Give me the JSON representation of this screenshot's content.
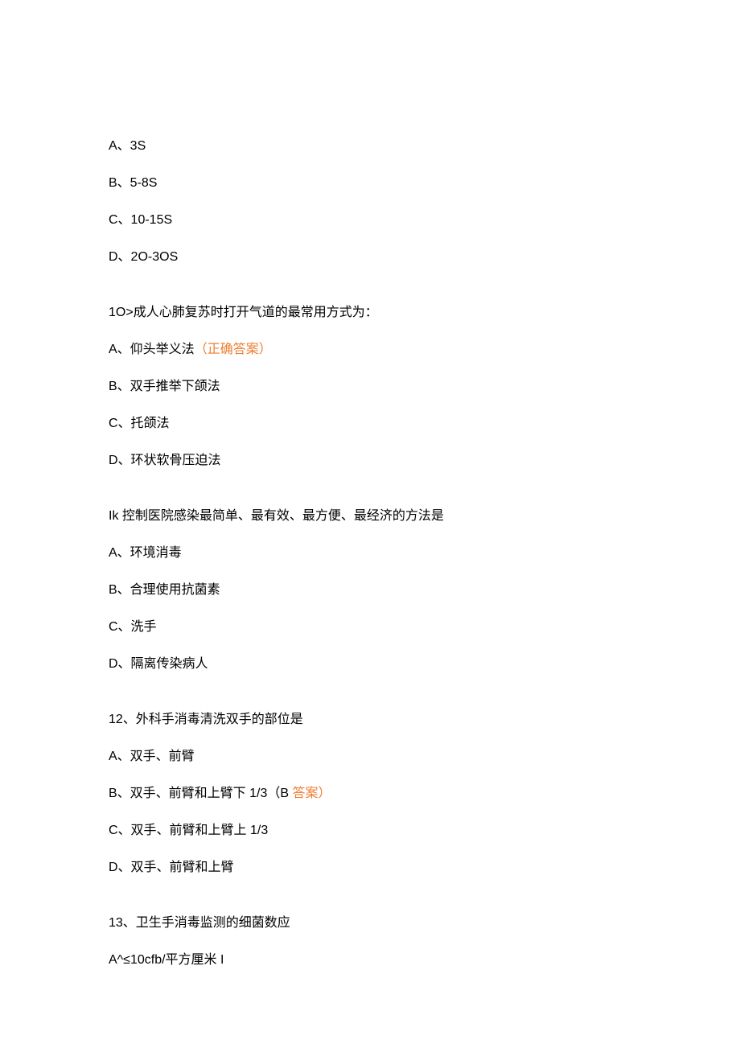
{
  "options_a": {
    "a": "A、3S",
    "b": "B、5-8S",
    "c": "C、10-15S",
    "d": "D、2O-3OS"
  },
  "q10": {
    "stem": "1O>成人心肺复苏时打开气道的最常用方式为：",
    "a_pre": "A、仰头举义法",
    "a_mark": "（正确答案）",
    "b": "B、双手推举下颌法",
    "c": "C、托颌法",
    "d": "D、环状软骨压迫法"
  },
  "q11": {
    "stem": "Ik 控制医院感染最简单、最有效、最方便、最经济的方法是",
    "a": "A、环境消毒",
    "b": "B、合理使用抗菌素",
    "c": "C、洗手",
    "d": "D、隔离传染病人"
  },
  "q12": {
    "stem": "12、外科手消毒清洗双手的部位是",
    "a": "A、双手、前臂",
    "b_pre": "B、双手、前臂和上臂下 1/3（B ",
    "b_mark": "答案）",
    "c": "C、双手、前臂和上臂上 1/3",
    "d": "D、双手、前臂和上臂"
  },
  "q13": {
    "stem": "13、卫生手消毒监测的细菌数应",
    "a": "A^≤10cfb/平方厘米 I"
  }
}
